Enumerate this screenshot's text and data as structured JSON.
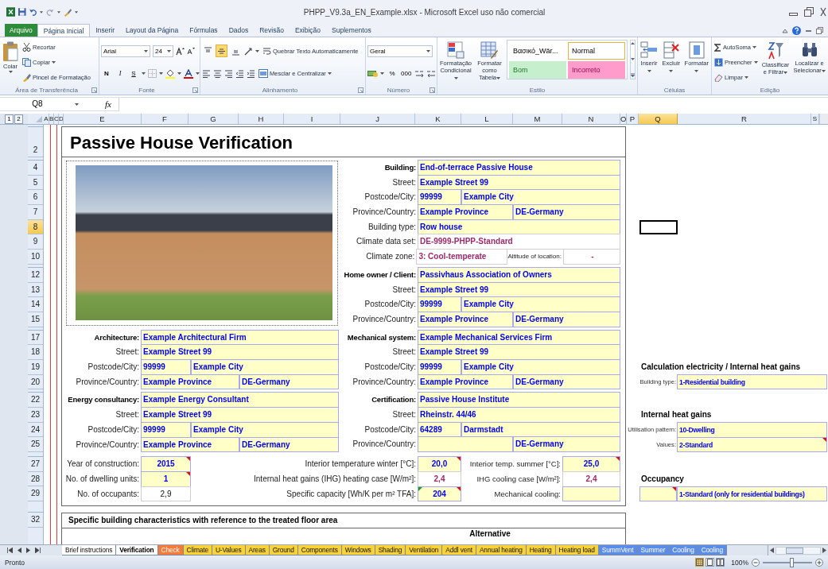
{
  "window": {
    "title": "PHPP_V9.3a_EN_Example.xlsx - Microsoft Excel uso não comercial"
  },
  "ribbon_tabs": [
    {
      "label": "Arquivo",
      "kind": "file",
      "selected": false
    },
    {
      "label": "Página Inicial",
      "kind": "tab",
      "selected": true
    },
    {
      "label": "Inserir",
      "kind": "tab",
      "selected": false
    },
    {
      "label": "Layout da Página",
      "kind": "tab",
      "selected": false
    },
    {
      "label": "Fórmulas",
      "kind": "tab",
      "selected": false
    },
    {
      "label": "Dados",
      "kind": "tab",
      "selected": false
    },
    {
      "label": "Revisão",
      "kind": "tab",
      "selected": false
    },
    {
      "label": "Exibição",
      "kind": "tab",
      "selected": false
    },
    {
      "label": "Suplementos",
      "kind": "tab",
      "selected": false
    }
  ],
  "clipboard": {
    "paste": "Colar",
    "cut": "Recortar",
    "copy": "Copiar",
    "painter": "Pincel de Formatação",
    "group": "Área de Transferência"
  },
  "font": {
    "name": "Arial",
    "size": "24",
    "bold": "N",
    "italic": "I",
    "underline": "S",
    "group": "Fonte"
  },
  "alignment": {
    "vertical": [
      {
        "selected": false
      },
      {
        "selected": true
      },
      {
        "selected": false
      }
    ],
    "wrap": "Quebrar Texto Automaticamente",
    "merge": "Mesclar e Centralizar",
    "group": "Alinhamento"
  },
  "number": {
    "format": "Geral",
    "percent": "%",
    "thousands": "000",
    "group": "Número"
  },
  "styles": {
    "conditional": "Formatação Condicional",
    "table": "Formatar como Tabela",
    "gallery": [
      {
        "label": "Βασικό_Wär...",
        "kind": "plain",
        "selected": false
      },
      {
        "label": "Normal",
        "kind": "normal",
        "selected": true
      },
      {
        "label": "Bom",
        "kind": "good",
        "selected": false
      },
      {
        "label": "Incorreto",
        "kind": "bad",
        "selected": false
      }
    ],
    "group": "Estilo"
  },
  "cells": {
    "buttons": [
      "Inserir",
      "Excluir",
      "Formatar"
    ],
    "group": "Células"
  },
  "editing": {
    "autosum": "AutoSoma",
    "fill": "Preencher",
    "clear": "Limpar",
    "sort": "Classificar e Filtrar",
    "find": "Localizar e Selecionar",
    "group": "Edição"
  },
  "formula_bar": {
    "name_box": "Q8",
    "function_label": "fx"
  },
  "sheet": {
    "outline_buttons": [
      "1",
      "2"
    ],
    "columns": [
      {
        "label": "A",
        "selected": false
      },
      {
        "label": "B",
        "selected": false
      },
      {
        "label": "C",
        "selected": false
      },
      {
        "label": "D",
        "selected": false
      },
      {
        "label": "E",
        "selected": false
      },
      {
        "label": "F",
        "selected": false
      },
      {
        "label": "G",
        "selected": false
      },
      {
        "label": "H",
        "selected": false
      },
      {
        "label": "I",
        "selected": false
      },
      {
        "label": "J",
        "selected": false
      },
      {
        "label": "K",
        "selected": false
      },
      {
        "label": "L",
        "selected": false
      },
      {
        "label": "M",
        "selected": false
      },
      {
        "label": "N",
        "selected": false
      },
      {
        "label": "O",
        "selected": false
      },
      {
        "label": "P",
        "selected": false
      },
      {
        "label": "Q",
        "selected": true
      },
      {
        "label": "R",
        "selected": false
      },
      {
        "label": "S",
        "selected": false
      }
    ],
    "row_groups": [
      [
        {
          "label": "2",
          "selected": false
        }
      ],
      [
        {
          "label": "4",
          "selected": false
        },
        {
          "label": "5",
          "selected": false
        },
        {
          "label": "6",
          "selected": false
        },
        {
          "label": "7",
          "selected": false
        },
        {
          "label": "8",
          "selected": true
        },
        {
          "label": "9",
          "selected": false
        },
        {
          "label": "10",
          "selected": false
        }
      ],
      [
        {
          "label": "12",
          "selected": false
        },
        {
          "label": "13",
          "selected": false
        },
        {
          "label": "14",
          "selected": false
        },
        {
          "label": "15",
          "selected": false
        }
      ],
      [
        {
          "label": "17",
          "selected": false
        },
        {
          "label": "18",
          "selected": false
        },
        {
          "label": "19",
          "selected": false
        },
        {
          "label": "20",
          "selected": false
        }
      ],
      [
        {
          "label": "22",
          "selected": false
        },
        {
          "label": "23",
          "selected": false
        },
        {
          "label": "24",
          "selected": false
        },
        {
          "label": "25",
          "selected": false
        }
      ],
      [
        {
          "label": "27",
          "selected": false
        },
        {
          "label": "28",
          "selected": false
        },
        {
          "label": "29",
          "selected": false
        }
      ],
      [
        {
          "label": "32",
          "selected": false
        }
      ]
    ],
    "title": "Passive House Verification",
    "left_groups": [
      {
        "title": "Architecture:",
        "value": "Example Architectural Firm",
        "fields": [
          {
            "kind": "text",
            "label": "Street:",
            "value": "Example Street 99"
          },
          {
            "kind": "postcode",
            "label": "Postcode/City:",
            "value": "99999",
            "value_2": "Example City"
          },
          {
            "kind": "province",
            "label": "Province/Country:",
            "value": "Example Province",
            "value_2": "DE-Germany"
          }
        ]
      },
      {
        "title": "Energy consultancy:",
        "value": "Example Energy Consultant",
        "fields": [
          {
            "kind": "text",
            "label": "Street:",
            "value": "Example Street 99"
          },
          {
            "kind": "postcode",
            "label": "Postcode/City:",
            "value": "99999",
            "value_2": "Example City"
          },
          {
            "kind": "province",
            "label": "Province/Country:",
            "value": "Example Province",
            "value_2": "DE-Germany"
          }
        ]
      }
    ],
    "right_groups": [
      {
        "title": "Building:",
        "value": "End-of-terrace Passive House",
        "fields": [
          {
            "kind": "text",
            "label": "Street:",
            "value": "Example Street 99"
          },
          {
            "kind": "postcode",
            "label": "Postcode/City:",
            "value": "99999",
            "value_2": "Example City"
          },
          {
            "kind": "province",
            "label": "Province/Country:",
            "value": "Example Province",
            "value_2": "DE-Germany"
          },
          {
            "kind": "text",
            "label": "Building type:",
            "value": "Row house"
          },
          {
            "kind": "computed",
            "label": "Climate data set:",
            "value": "DE-9999-PHPP-Standard"
          },
          {
            "kind": "climate",
            "label": "Climate zone:",
            "value": "3: Cool-temperate",
            "label_2": "Altitude of location:",
            "value_2": "-"
          }
        ]
      },
      {
        "title": "Home owner / Client:",
        "value": "Passivhaus Association of Owners",
        "fields": [
          {
            "kind": "text",
            "label": "Street:",
            "value": "Example Street 99"
          },
          {
            "kind": "postcode",
            "label": "Postcode/City:",
            "value": "99999",
            "value_2": "Example City"
          },
          {
            "kind": "province",
            "label": "Province/Country:",
            "value": "Example Province",
            "value_2": "DE-Germany"
          }
        ]
      },
      {
        "title": "Mechanical system:",
        "value": "Example Mechanical Services Firm",
        "fields": [
          {
            "kind": "text",
            "label": "Street:",
            "value": "Example Street 99"
          },
          {
            "kind": "postcode",
            "label": "Postcode/City:",
            "value": "99999",
            "value_2": "Example City"
          },
          {
            "kind": "province",
            "label": "Province/Country:",
            "value": "Example Province",
            "value_2": "DE-Germany"
          }
        ]
      },
      {
        "title": "Certification:",
        "value": "Passive House Institute",
        "fields": [
          {
            "kind": "text",
            "label": "Street:",
            "value": "Rheinstr. 44/46"
          },
          {
            "kind": "postcode",
            "label": "Postcode/City:",
            "value": "64289",
            "value_2": "Darmstadt"
          },
          {
            "kind": "province",
            "label": "Province/Country:",
            "value_2": "DE-Germany"
          }
        ]
      }
    ],
    "parameter_rows": [
      [
        {
          "label": "Year of construction:",
          "value": "2015",
          "kind": "input",
          "comment": true,
          "warning": false
        },
        {
          "label": "Interior temperature winter [°C]:",
          "value": "20,0",
          "kind": "input",
          "comment": true,
          "warning": false
        },
        {
          "label": "Interior temp. summer [°C]:",
          "value": "25,0",
          "kind": "input",
          "comment": true,
          "warning": false
        }
      ],
      [
        {
          "label": "No. of dwelling units:",
          "value": "1",
          "kind": "input",
          "comment": true,
          "warning": false
        },
        {
          "label": "Internal heat gains (IHG) heating case [W/m²]:",
          "value": "2,4",
          "kind": "computed",
          "comment": false,
          "warning": false
        },
        {
          "label": "IHG cooling case [W/m²]:",
          "value": "2,4",
          "kind": "computed",
          "comment": false,
          "warning": false
        }
      ],
      [
        {
          "label": "No. of occupants:",
          "value": "2,9",
          "kind": "plain",
          "comment": false,
          "warning": false
        },
        {
          "label": "Specific capacity [Wh/K per m² TFA]:",
          "value": "204",
          "kind": "input",
          "comment": true,
          "warning": true
        },
        {
          "label": "Mechanical cooling:",
          "kind": "input",
          "comment": false,
          "warning": false
        }
      ]
    ],
    "side_sections": [
      {
        "title": "Calculation electricity / Internal heat gains",
        "fields": [
          {
            "label": "Building type:",
            "value": "1-Residential building",
            "comment": false
          }
        ]
      },
      {
        "title": "Internal heat gains",
        "fields": [
          {
            "label": "Utilisation pattern:",
            "value": "10-Dwelling",
            "comment": false
          },
          {
            "label": "Values:",
            "value": "2-Standard",
            "comment": true
          }
        ]
      },
      {
        "title": "Occupancy",
        "fields": [
          {
            "value": "1-Standard (only for residential buildings)",
            "comment": true
          }
        ]
      }
    ],
    "section_2": {
      "title": "Specific building characteristics with reference to the treated floor area",
      "column_heading": "Alternative"
    }
  },
  "sheet_tabs": [
    {
      "label": "Brief instructions",
      "selected": false,
      "color": "#ffffff"
    },
    {
      "label": "Verification",
      "selected": true,
      "color": "#ffffff"
    },
    {
      "label": "Check",
      "selected": false,
      "color": "#f47b3a"
    },
    {
      "label": "Climate",
      "selected": false,
      "color": "#f8d23a"
    },
    {
      "label": "U-Values",
      "selected": false,
      "color": "#f8d23a"
    },
    {
      "label": "Areas",
      "selected": false,
      "color": "#f8d23a"
    },
    {
      "label": "Ground",
      "selected": false,
      "color": "#f8d23a"
    },
    {
      "label": "Components",
      "selected": false,
      "color": "#f8d23a"
    },
    {
      "label": "Windows",
      "selected": false,
      "color": "#f8d23a"
    },
    {
      "label": "Shading",
      "selected": false,
      "color": "#f8d23a"
    },
    {
      "label": "Ventilation",
      "selected": false,
      "color": "#f8d23a"
    },
    {
      "label": "Addl vent",
      "selected": false,
      "color": "#f8d23a"
    },
    {
      "label": "Annual heating",
      "selected": false,
      "color": "#f8d23a"
    },
    {
      "label": "Heating",
      "selected": false,
      "color": "#f8d23a"
    },
    {
      "label": "Heating load",
      "selected": false,
      "color": "#f8d23a"
    },
    {
      "label": "SummVent",
      "selected": false,
      "color": "#5b8ce6"
    },
    {
      "label": "Summer",
      "selected": false,
      "color": "#5b8ce6"
    },
    {
      "label": "Cooling",
      "selected": false,
      "color": "#5b8ce6"
    },
    {
      "label": "Cooling",
      "selected": false,
      "color": "#5b8ce6"
    }
  ],
  "status_bar": {
    "text": "Pronto",
    "views": [
      {
        "selected": true
      },
      {
        "selected": false
      },
      {
        "selected": false
      }
    ],
    "zoom": "100%",
    "zoom_slider": {
      "level": 0.58
    }
  }
}
